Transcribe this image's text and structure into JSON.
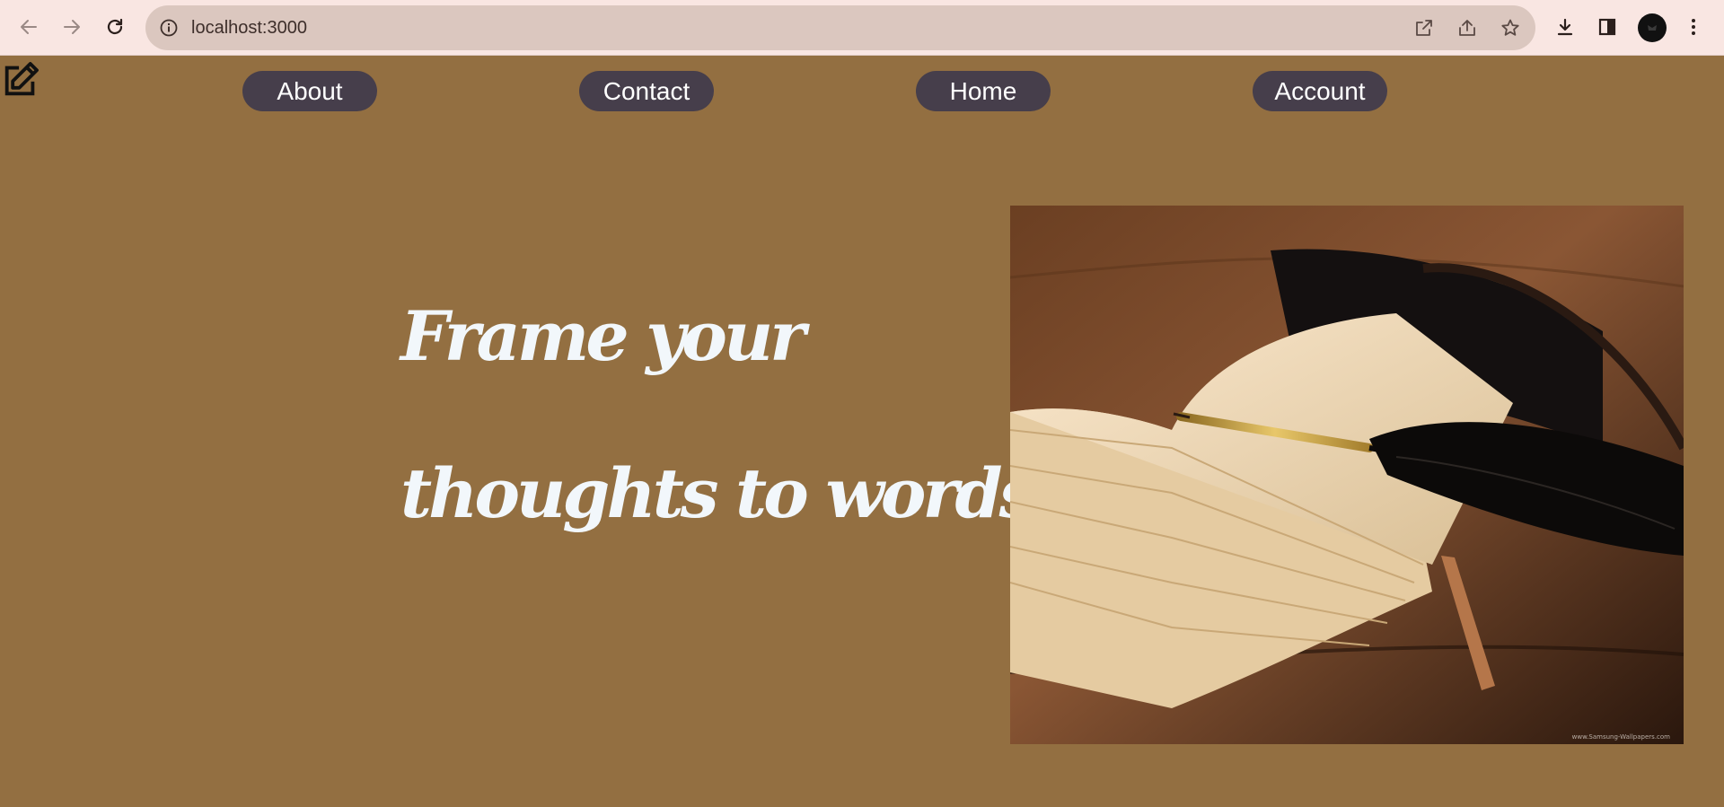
{
  "browser": {
    "url": "localhost:3000",
    "icons": {
      "back": "arrow-left-icon",
      "forward": "arrow-right-icon",
      "reload": "reload-icon",
      "site_info": "info-icon",
      "open_in_app": "open-external-icon",
      "share": "share-icon",
      "bookmark": "star-icon",
      "download": "download-icon",
      "side_panel": "side-panel-icon",
      "menu": "kebab-menu-icon"
    }
  },
  "page": {
    "background_color": "#936f41",
    "edit_icon": "edit-icon",
    "nav": {
      "pill_color": "#463e4b",
      "items": [
        {
          "label": "About"
        },
        {
          "label": "Contact"
        },
        {
          "label": "Home"
        },
        {
          "label": "Account"
        }
      ]
    },
    "hero": {
      "line1": "Frame your",
      "line2": "thoughts to words",
      "image_label": "open book with quill pen"
    }
  }
}
